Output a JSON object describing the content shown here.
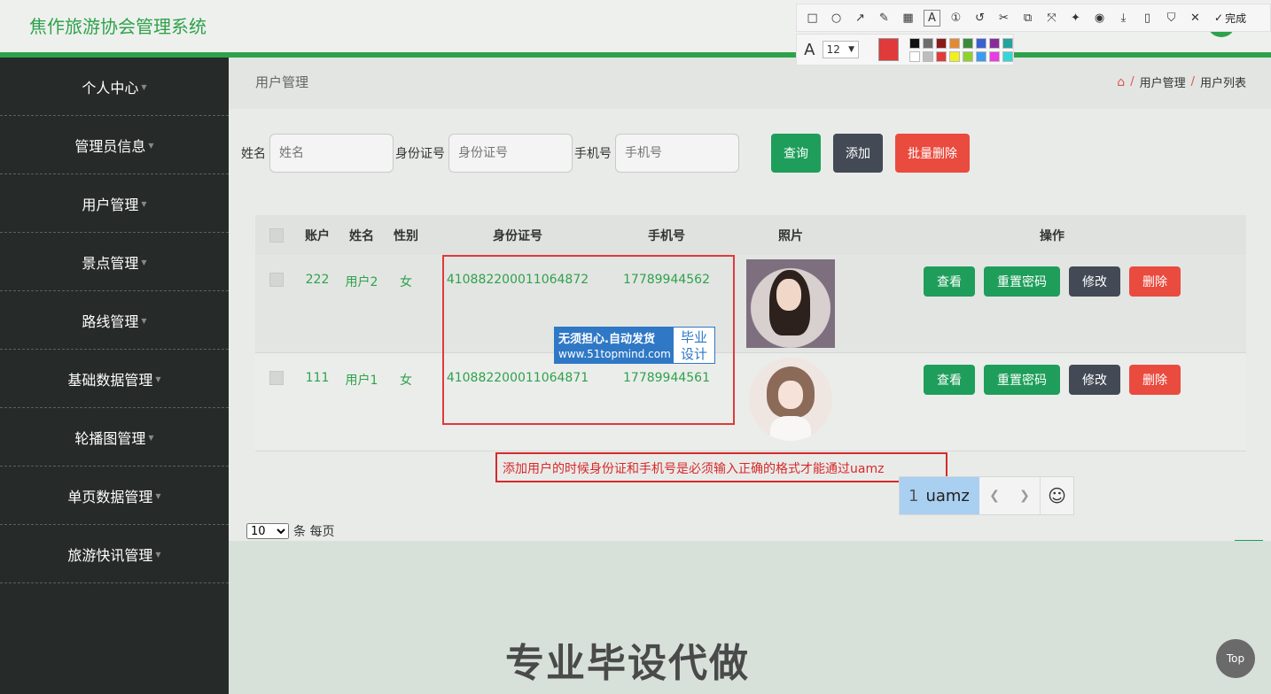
{
  "app_title": "焦作旅游协会管理系统",
  "sidebar": {
    "items": [
      {
        "label": "个人中心"
      },
      {
        "label": "管理员信息"
      },
      {
        "label": "用户管理"
      },
      {
        "label": "景点管理"
      },
      {
        "label": "路线管理"
      },
      {
        "label": "基础数据管理"
      },
      {
        "label": "轮播图管理"
      },
      {
        "label": "单页数据管理"
      },
      {
        "label": "旅游快讯管理"
      }
    ]
  },
  "page": {
    "title": "用户管理",
    "breadcrumb": [
      "用户管理",
      "用户列表"
    ]
  },
  "search": {
    "name_label": "姓名",
    "name_placeholder": "姓名",
    "id_label": "身份证号",
    "id_placeholder": "身份证号",
    "phone_label": "手机号",
    "phone_placeholder": "手机号",
    "query_label": "查询",
    "add_label": "添加",
    "batch_delete_label": "批量删除"
  },
  "table": {
    "headers": [
      "账户",
      "姓名",
      "性别",
      "身份证号",
      "手机号",
      "照片",
      "操作"
    ],
    "rows": [
      {
        "account": "222",
        "name": "用户2",
        "sex": "女",
        "id_card": "410882200011064872",
        "phone": "17789944562"
      },
      {
        "account": "111",
        "name": "用户1",
        "sex": "女",
        "id_card": "410882200011064871",
        "phone": "17789944561"
      }
    ],
    "ops": {
      "view": "查看",
      "reset": "重置密码",
      "edit": "修改",
      "delete": "删除"
    }
  },
  "pager": {
    "page_size": "10",
    "per_page_text": "条 每页",
    "current_page": "1"
  },
  "overlay": {
    "watermark_line1": "无须担心.自动发货",
    "watermark_line2": "www.51topmind.com",
    "watermark_badge_1": "毕业",
    "watermark_badge_2": "设计",
    "note_text": "添加用户的时候身份证和手机号是必须输入正确的格式才能通过uamz",
    "ime_index": "1",
    "ime_candidate": "uamz",
    "promo_text": "专业毕设代做",
    "top_label": "Top"
  },
  "toolbar": {
    "done_label": "完成",
    "font_size": "12",
    "current_color": "#e03a3a",
    "palette": [
      "#111111",
      "#6d6d6d",
      "#8b1a1a",
      "#e28a35",
      "#3c8a3c",
      "#3a5fcf",
      "#8a2b9a",
      "#24a39c",
      "#ffffff",
      "#bdbdbd",
      "#e03a3a",
      "#f2ef1e",
      "#8fd12f",
      "#3a9cf0",
      "#e93ce2",
      "#35d6d6"
    ]
  },
  "colors": {
    "accent": "#2ea24a",
    "danger": "#ea4b3f",
    "dark": "#434a55"
  }
}
